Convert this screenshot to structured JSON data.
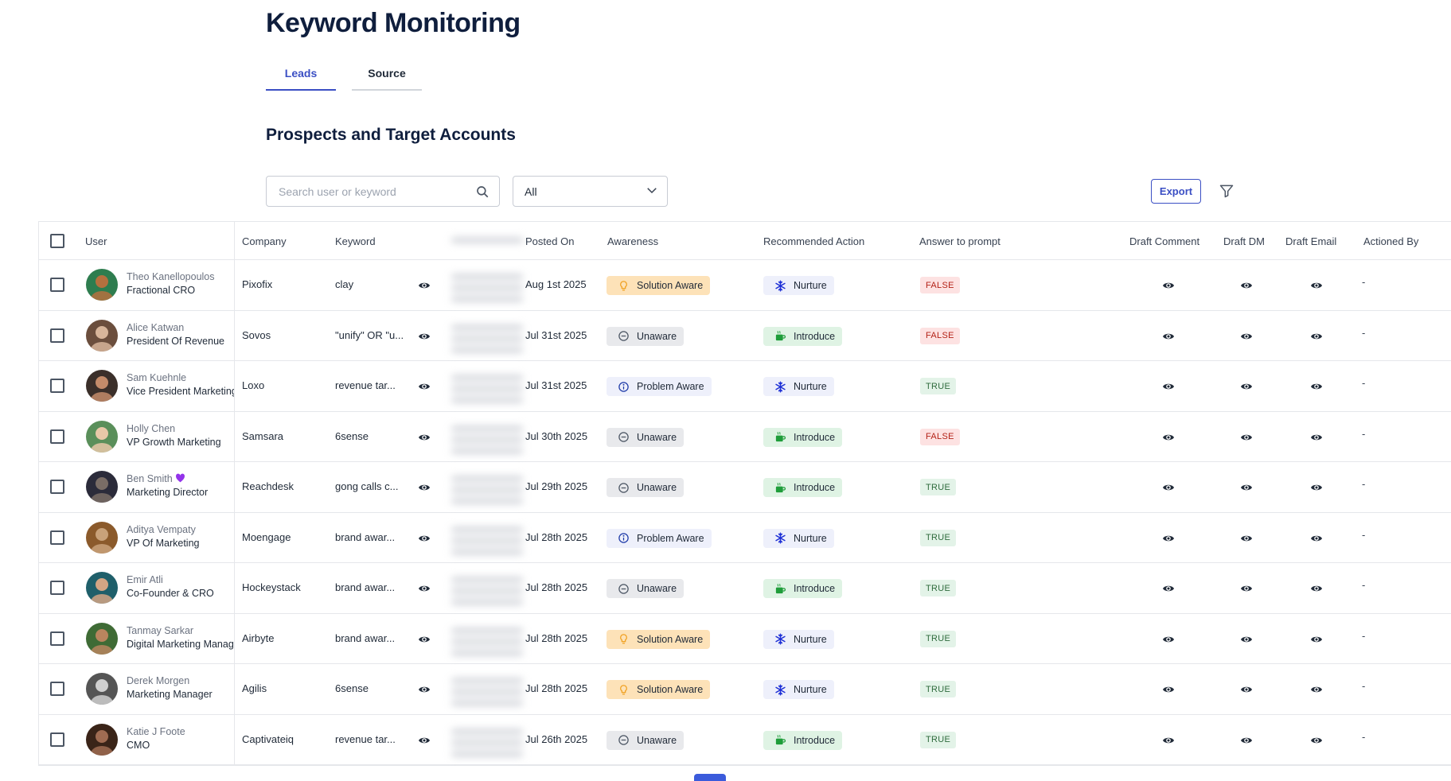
{
  "page": {
    "title": "Keyword Monitoring",
    "section_title": "Prospects and Target Accounts"
  },
  "tabs": [
    {
      "label": "Leads",
      "active": true
    },
    {
      "label": "Source",
      "active": false
    }
  ],
  "search": {
    "placeholder": "Search user or keyword",
    "value": ""
  },
  "filter_select": {
    "value": "All"
  },
  "toolbar": {
    "export_label": "Export"
  },
  "table": {
    "headers": {
      "user": "User",
      "company": "Company",
      "keyword": "Keyword",
      "posted_on": "Posted On",
      "awareness": "Awareness",
      "recommended_action": "Recommended Action",
      "answer": "Answer to prompt",
      "draft_comment": "Draft Comment",
      "draft_dm": "Draft DM",
      "draft_email": "Draft Email",
      "actioned_by": "Actioned By"
    },
    "rows": [
      {
        "name": "Theo Kanellopoulos",
        "title": "Fractional CRO",
        "company": "Pixofix",
        "keyword": "clay",
        "posted_on": "Aug 1st 2025",
        "awareness": "Solution Aware",
        "action": "Nurture",
        "answer": "FALSE",
        "actioned_by": "-"
      },
      {
        "name": "Alice Katwan",
        "title": "President Of Revenue",
        "company": "Sovos",
        "keyword": "\"unify\" OR \"u...",
        "posted_on": "Jul 31st 2025",
        "awareness": "Unaware",
        "action": "Introduce",
        "answer": "FALSE",
        "actioned_by": "-"
      },
      {
        "name": "Sam Kuehnle",
        "title": "Vice President Marketing",
        "company": "Loxo",
        "keyword": "revenue tar...",
        "posted_on": "Jul 31st 2025",
        "awareness": "Problem Aware",
        "action": "Nurture",
        "answer": "TRUE",
        "actioned_by": "-"
      },
      {
        "name": "Holly Chen",
        "title": "VP Growth Marketing",
        "company": "Samsara",
        "keyword": "6sense",
        "posted_on": "Jul 30th 2025",
        "awareness": "Unaware",
        "action": "Introduce",
        "answer": "FALSE",
        "actioned_by": "-"
      },
      {
        "name": "Ben Smith",
        "title": "Marketing Director",
        "company": "Reachdesk",
        "keyword": "gong calls c...",
        "posted_on": "Jul 29th 2025",
        "awareness": "Unaware",
        "action": "Introduce",
        "answer": "TRUE",
        "actioned_by": "-",
        "heart": true
      },
      {
        "name": "Aditya Vempaty",
        "title": "VP Of Marketing",
        "company": "Moengage",
        "keyword": "brand awar...",
        "posted_on": "Jul 28th 2025",
        "awareness": "Problem Aware",
        "action": "Nurture",
        "answer": "TRUE",
        "actioned_by": "-"
      },
      {
        "name": "Emir Atli",
        "title": "Co-Founder & CRO",
        "company": "Hockeystack",
        "keyword": "brand awar...",
        "posted_on": "Jul 28th 2025",
        "awareness": "Unaware",
        "action": "Introduce",
        "answer": "TRUE",
        "actioned_by": "-"
      },
      {
        "name": "Tanmay Sarkar",
        "title": "Digital Marketing Manager",
        "company": "Airbyte",
        "keyword": "brand awar...",
        "posted_on": "Jul 28th 2025",
        "awareness": "Solution Aware",
        "action": "Nurture",
        "answer": "TRUE",
        "actioned_by": "-"
      },
      {
        "name": "Derek Morgen",
        "title": "Marketing Manager",
        "company": "Agilis",
        "keyword": "6sense",
        "posted_on": "Jul 28th 2025",
        "awareness": "Solution Aware",
        "action": "Nurture",
        "answer": "TRUE",
        "actioned_by": "-"
      },
      {
        "name": "Katie J Foote",
        "title": "CMO",
        "company": "Captivateiq",
        "keyword": "revenue tar...",
        "posted_on": "Jul 26th 2025",
        "awareness": "Unaware",
        "action": "Introduce",
        "answer": "TRUE",
        "actioned_by": "-"
      }
    ]
  },
  "colors": {
    "accent": "#3b4fc4",
    "solution_aware_bg": "#fde2b8",
    "solution_aware_fg": "#1f2937",
    "solution_aware_icon": "#f0a020",
    "unaware_bg": "#e8e9ec",
    "problem_aware_bg": "#eef0fb",
    "problem_aware_icon": "#1e3aa8",
    "nurture_bg": "#eef0fb",
    "nurture_icon": "#1d2fd6",
    "introduce_bg": "#dff3e4",
    "introduce_icon": "#1f9d3a",
    "false_bg": "#fde2e2",
    "false_fg": "#b42318",
    "true_bg": "#e3f3e8",
    "true_fg": "#2f6b3d"
  },
  "icons": {
    "awareness": {
      "Solution Aware": "bulb-icon",
      "Unaware": "minus-circle-icon",
      "Problem Aware": "info-icon"
    },
    "action": {
      "Nurture": "snowflake-icon",
      "Introduce": "coffee-icon"
    },
    "columns": [
      "eye-icon"
    ],
    "toolbar": [
      "search-icon",
      "chevron-down-icon",
      "filter-icon"
    ]
  }
}
